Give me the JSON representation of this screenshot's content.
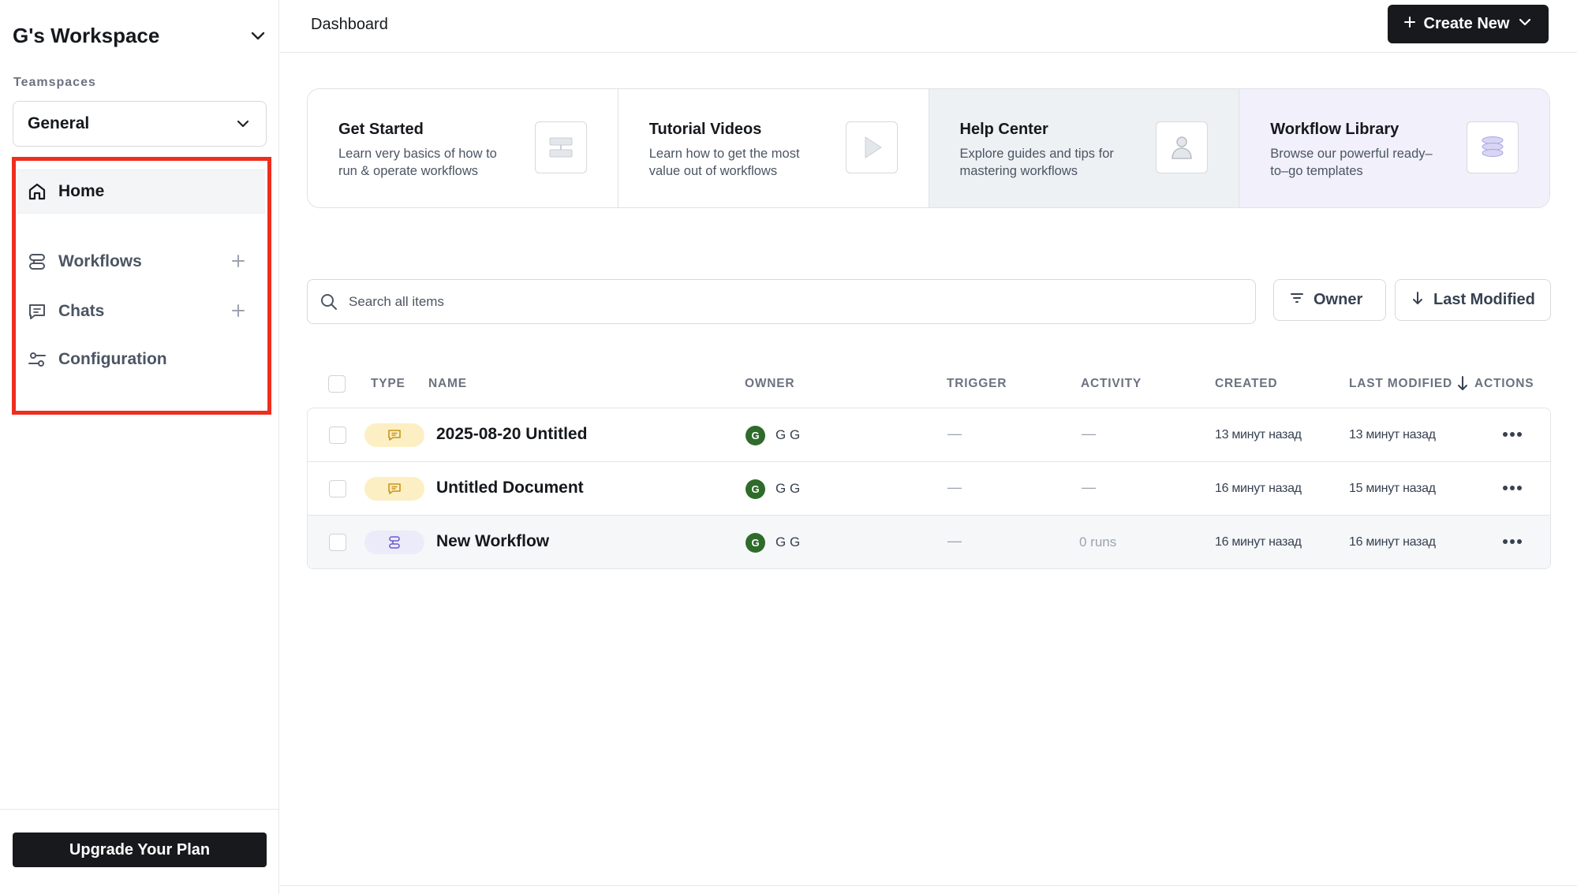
{
  "workspace": {
    "name": "G's Workspace"
  },
  "teamspaces": {
    "label": "Teamspaces",
    "selected": "General"
  },
  "nav": {
    "items": [
      {
        "label": "Home",
        "icon": "home-icon",
        "active": true
      },
      {
        "label": "Workflows",
        "icon": "workflow-icon",
        "has_add": true
      },
      {
        "label": "Chats",
        "icon": "chat-icon",
        "has_add": true
      },
      {
        "label": "Configuration",
        "icon": "sliders-icon"
      }
    ]
  },
  "upgrade_label": "Upgrade Your Plan",
  "topbar": {
    "breadcrumb": "Dashboard",
    "create_label": "Create New"
  },
  "cards": [
    {
      "title": "Get Started",
      "desc": "Learn very basics of how to run & operate workflows",
      "icon": "layout-icon"
    },
    {
      "title": "Tutorial Videos",
      "desc": "Learn how to get the most value out of workflows",
      "icon": "play-icon"
    },
    {
      "title": "Help Center",
      "desc": "Explore guides and tips for mastering workflows",
      "icon": "person-icon"
    },
    {
      "title": "Workflow Library",
      "desc": "Browse our powerful ready–to–go templates",
      "icon": "stack-icon"
    }
  ],
  "search": {
    "placeholder": "Search all items"
  },
  "filters": {
    "owner_label": "Owner",
    "sort_label": "Last Modified"
  },
  "table": {
    "columns": {
      "type": "TYPE",
      "name": "NAME",
      "owner": "OWNER",
      "trigger": "TRIGGER",
      "activity": "ACTIVITY",
      "created": "CREATED",
      "last_modified": "LAST MODIFIED",
      "actions": "ACTIONS"
    },
    "rows": [
      {
        "type": "chat",
        "name": "2025-08-20 Untitled",
        "owner_initial": "G",
        "owner": "G G",
        "trigger": "—",
        "activity": "—",
        "created": "13 минут назад",
        "modified": "13 минут назад"
      },
      {
        "type": "chat",
        "name": "Untitled Document",
        "owner_initial": "G",
        "owner": "G G",
        "trigger": "—",
        "activity": "—",
        "created": "16 минут назад",
        "modified": "15 минут назад"
      },
      {
        "type": "workflow",
        "name": "New Workflow",
        "owner_initial": "G",
        "owner": "G G",
        "trigger": "—",
        "activity": "0 runs",
        "created": "16 минут назад",
        "modified": "16 минут назад"
      }
    ]
  },
  "colors": {
    "highlight_border": "#ee2e1e",
    "dark_button": "#17191c",
    "chat_badge": "#fcefc4",
    "workflow_badge": "#ecebfa",
    "avatar": "#2f6b2a"
  }
}
